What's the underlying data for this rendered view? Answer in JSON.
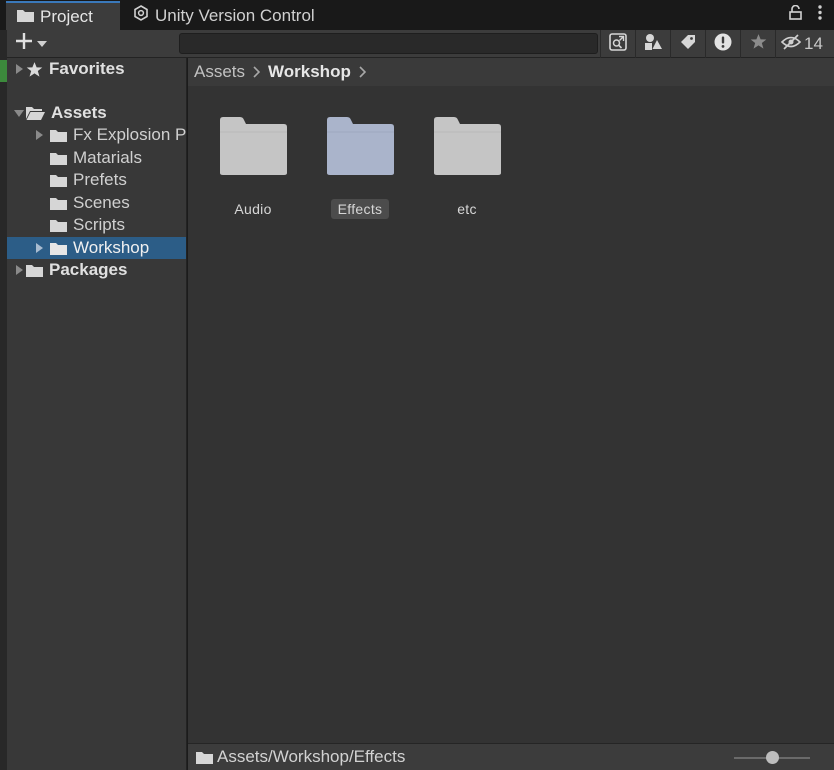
{
  "tabs": [
    {
      "label": "Project",
      "icon": "folder-icon",
      "active": true
    },
    {
      "label": "Unity Version Control",
      "icon": "version-control-icon",
      "active": false
    }
  ],
  "toolbar": {
    "create_icon": "plus-icon",
    "search_value": "",
    "search_placeholder": "",
    "hidden_packages_count": "14"
  },
  "sidebar": {
    "favorites": "Favorites",
    "assets": "Assets",
    "items": [
      {
        "label": "Fx Explosion P",
        "has_children": true
      },
      {
        "label": "Matarials",
        "has_children": false
      },
      {
        "label": "Prefets",
        "has_children": false
      },
      {
        "label": "Scenes",
        "has_children": false
      },
      {
        "label": "Scripts",
        "has_children": false
      },
      {
        "label": "Workshop",
        "has_children": true,
        "selected": true
      }
    ],
    "packages": "Packages"
  },
  "breadcrumb": [
    "Assets",
    "Workshop"
  ],
  "assets": [
    {
      "label": "Audio",
      "selected": false
    },
    {
      "label": "Effects",
      "selected": true
    },
    {
      "label": "etc",
      "selected": false
    }
  ],
  "status": {
    "path": "Assets/Workshop/Effects",
    "zoom_fraction": 0.5
  },
  "colors": {
    "selection": "#2c5d87",
    "folder": "#c2c2c2",
    "folder_selected": "#a9b3c9",
    "tab_accent": "#3a79bb"
  }
}
